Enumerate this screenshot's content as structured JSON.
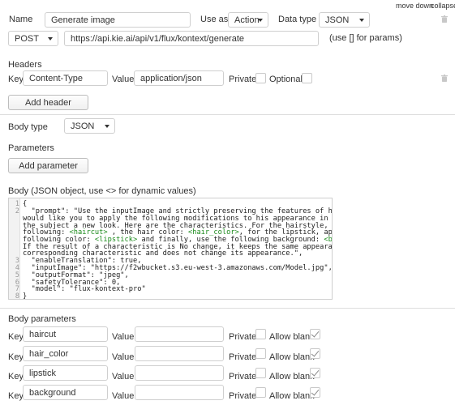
{
  "topbar": {
    "move_down": "move down",
    "collapse": "collapse"
  },
  "row1": {
    "name_label": "Name",
    "name_value": "Generate image",
    "use_as_label": "Use as",
    "use_as_value": "Action",
    "data_type_label": "Data type",
    "data_type_value": "JSON"
  },
  "row2": {
    "method": "POST",
    "url": "https://api.kie.ai/api/v1/flux/kontext/generate",
    "hint": "(use [] for params)"
  },
  "headers": {
    "title": "Headers",
    "key_label": "Key",
    "key_value": "Content-Type",
    "value_label": "Value",
    "value_value": "application/json",
    "private_label": "Private",
    "optional_label": "Optional",
    "add_button": "Add header"
  },
  "body_type": {
    "label": "Body type",
    "value": "JSON"
  },
  "parameters": {
    "title": "Parameters",
    "add_button": "Add parameter"
  },
  "body": {
    "title": "Body (JSON object, use <> for dynamic values)",
    "line_numbers": [
      "1",
      "2",
      "",
      "",
      "",
      "",
      "",
      "3",
      "4",
      "5",
      "6",
      "7",
      "8"
    ],
    "lines": [
      "{",
      "  \"prompt\": \"Use the inputImage and strictly preserving the features of his face. I",
      "would like you to apply the following modifications to his appearance in order to give",
      "the subject a new look. Here are the characteristics. For the hairstyle, adopt the",
      "following: ",
      "If the result of a characteristic is No change, it keeps the same appearance for the",
      "corresponding characteristic and does not change its appearance.\",",
      "  \"enableTranslation\": true,",
      "  \"inputImage\": \"https://f2wbucket.s3.eu-west-3.amazonaws.com/Model.jpg\",",
      "  \"outputFormat\": \"jpeg\",",
      "  \"safetyTolerance\": 0,",
      "  \"model\": \"flux-kontext-pro\"",
      "}"
    ],
    "line5_parts": [
      "following: ",
      "<haircut>",
      " , the hair color: ",
      "<hair_color>",
      ", for the lipstick, apply the"
    ],
    "line6_parts": [
      "following color: ",
      "<lipstick>",
      " and finally, use the following background: ",
      "<background>",
      "."
    ]
  },
  "body_parameters": {
    "title": "Body parameters",
    "key_label": "Key",
    "value_label": "Value",
    "private_label": "Private",
    "allow_blank_label": "Allow blank",
    "rows": [
      {
        "key": "haircut",
        "value": ""
      },
      {
        "key": "hair_color",
        "value": ""
      },
      {
        "key": "lipstick",
        "value": ""
      },
      {
        "key": "background",
        "value": ""
      }
    ]
  },
  "icons": [
    "caret-down-icon",
    "trash-icon",
    "checkmark-icon"
  ],
  "colors": {
    "dynamic_value": "#1a8a1a",
    "border": "#cfcfcf",
    "divider": "#dddddd"
  }
}
